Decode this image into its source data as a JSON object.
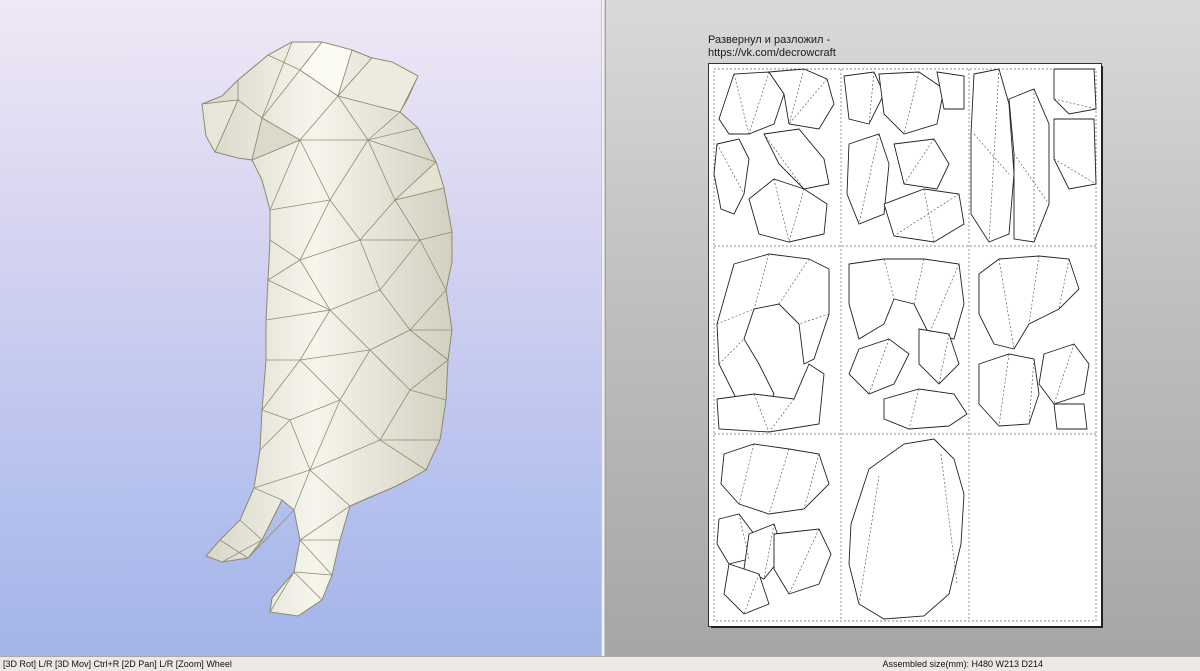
{
  "sheet": {
    "caption_line1": "Развернул и разложил -",
    "caption_line2": "https://vk.com/decrowcraft"
  },
  "statusbar": {
    "controls_hint": "[3D Rot] L/R [3D Mov] Ctrl+R [2D Pan] L/R [Zoom] Wheel",
    "assembled_size": "Assembled size(mm): H480 W213 D214"
  },
  "model": {
    "subject": "low-poly sitting dog",
    "fill_color": "#f3f1e6",
    "edge_color": "#8c8a70"
  }
}
